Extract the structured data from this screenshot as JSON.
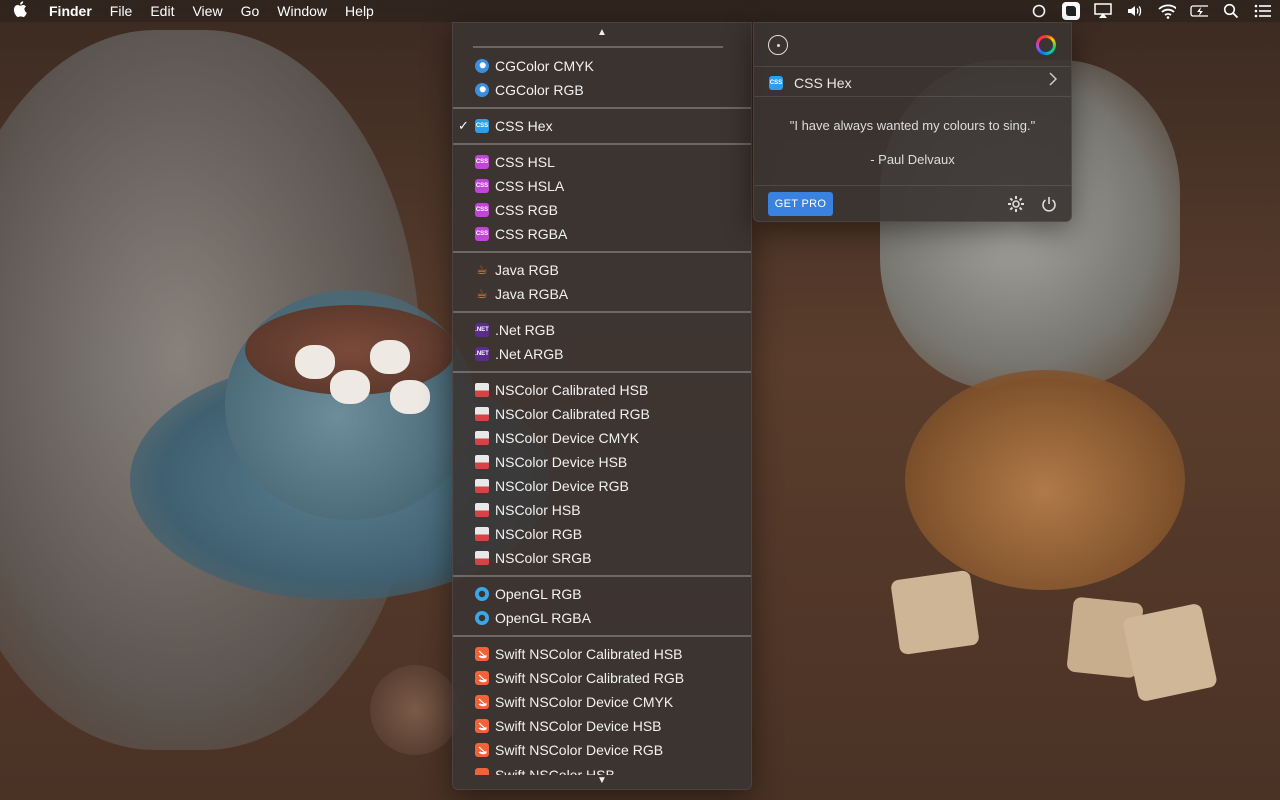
{
  "menubar": {
    "app_name": "Finder",
    "menus": [
      "File",
      "Edit",
      "View",
      "Go",
      "Window",
      "Help"
    ],
    "status_icons": [
      "circle-status-icon",
      "color-app-icon",
      "airplay-icon",
      "volume-icon",
      "wifi-icon",
      "battery-icon",
      "spotlight-icon",
      "notification-center-icon"
    ]
  },
  "dropdown": {
    "selected": "CSS Hex",
    "groups": [
      {
        "items": [
          {
            "label": "CGColor CMYK",
            "icon": "cgcolor-icon"
          },
          {
            "label": "CGColor RGB",
            "icon": "cgcolor-icon"
          }
        ]
      },
      {
        "items": [
          {
            "label": "CSS Hex",
            "icon": "css-icon",
            "icon_text": "CSS",
            "checked": true
          }
        ]
      },
      {
        "items": [
          {
            "label": "CSS HSL",
            "icon": "css-icon",
            "icon_text": "CSS"
          },
          {
            "label": "CSS HSLA",
            "icon": "css-icon",
            "icon_text": "CSS"
          },
          {
            "label": "CSS RGB",
            "icon": "css-icon",
            "icon_text": "CSS"
          },
          {
            "label": "CSS RGBA",
            "icon": "css-icon",
            "icon_text": "CSS"
          }
        ]
      },
      {
        "items": [
          {
            "label": "Java RGB",
            "icon": "java-icon"
          },
          {
            "label": "Java RGBA",
            "icon": "java-icon"
          }
        ]
      },
      {
        "items": [
          {
            "label": ".Net RGB",
            "icon": "dotnet-icon",
            "icon_text": ".NET"
          },
          {
            "label": ".Net ARGB",
            "icon": "dotnet-icon",
            "icon_text": ".NET"
          }
        ]
      },
      {
        "items": [
          {
            "label": "NSColor Calibrated HSB",
            "icon": "nscolor-icon"
          },
          {
            "label": "NSColor Calibrated RGB",
            "icon": "nscolor-icon"
          },
          {
            "label": "NSColor Device CMYK",
            "icon": "nscolor-icon"
          },
          {
            "label": "NSColor Device HSB",
            "icon": "nscolor-icon"
          },
          {
            "label": "NSColor Device RGB",
            "icon": "nscolor-icon"
          },
          {
            "label": "NSColor HSB",
            "icon": "nscolor-icon"
          },
          {
            "label": "NSColor RGB",
            "icon": "nscolor-icon"
          },
          {
            "label": "NSColor SRGB",
            "icon": "nscolor-icon"
          }
        ]
      },
      {
        "items": [
          {
            "label": "OpenGL RGB",
            "icon": "opengl-icon"
          },
          {
            "label": "OpenGL RGBA",
            "icon": "opengl-icon"
          }
        ]
      },
      {
        "items": [
          {
            "label": "Swift NSColor Calibrated HSB",
            "icon": "swift-icon"
          },
          {
            "label": "Swift NSColor Calibrated RGB",
            "icon": "swift-icon"
          },
          {
            "label": "Swift NSColor Device CMYK",
            "icon": "swift-icon"
          },
          {
            "label": "Swift NSColor Device HSB",
            "icon": "swift-icon"
          },
          {
            "label": "Swift NSColor Device RGB",
            "icon": "swift-icon"
          },
          {
            "label": "Swift NSColor HSB",
            "icon": "swift-icon",
            "clipped": true
          }
        ]
      }
    ]
  },
  "panel": {
    "format": {
      "label": "CSS Hex",
      "icon_text": "CSS"
    },
    "quote": "\"I have always wanted my colours to sing.\"",
    "author": "- Paul Delvaux",
    "get_pro_label": "GET PRO"
  },
  "colors": {
    "accent": "#3a82e0",
    "css_blue": "#2d9ee8",
    "css_purple": "#c246d6",
    "dotnet_purple": "#5b2b8e",
    "swift_orange": "#f0623a",
    "java_orange": "#f0803a"
  }
}
